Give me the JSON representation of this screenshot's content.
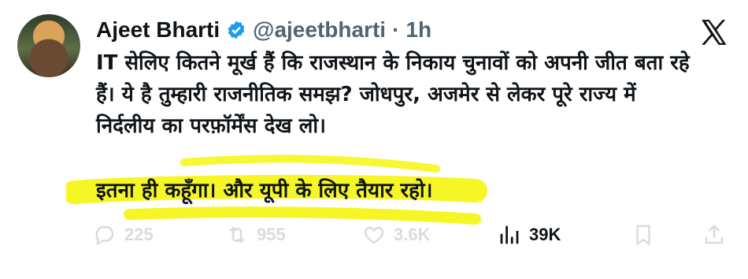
{
  "tweet": {
    "author_name": "Ajeet Bharti",
    "handle": "@ajeetbharti",
    "separator": "·",
    "time": "1h",
    "body": "IT सेलिए कितने मूर्ख हैं कि राजस्थान के निकाय चुनावों को अपनी जीत बता रहे\nहैं। ये है तुम्हारी राजनीतिक समझ? जोधपुर, अजमेर से लेकर पूरे राज्य में\nनिर्दलीय का परफ़ॉर्मेंस देख लो।",
    "highlighted_line": "इतना ही कहूँगा। और यूपी के लिए तैयार रहो।"
  },
  "actions": {
    "replies": "225",
    "reposts": "955",
    "likes": "3.6K",
    "views": "39K"
  },
  "colors": {
    "accent": "#1d9bf0",
    "highlight": "#f5f500",
    "muted": "#536471"
  },
  "icons": {
    "verified": "verified-badge-icon",
    "platform": "x-logo-icon",
    "reply": "reply-icon",
    "repost": "repost-icon",
    "like": "like-icon",
    "views": "views-chart-icon",
    "bookmark": "bookmark-icon",
    "share": "share-icon"
  }
}
